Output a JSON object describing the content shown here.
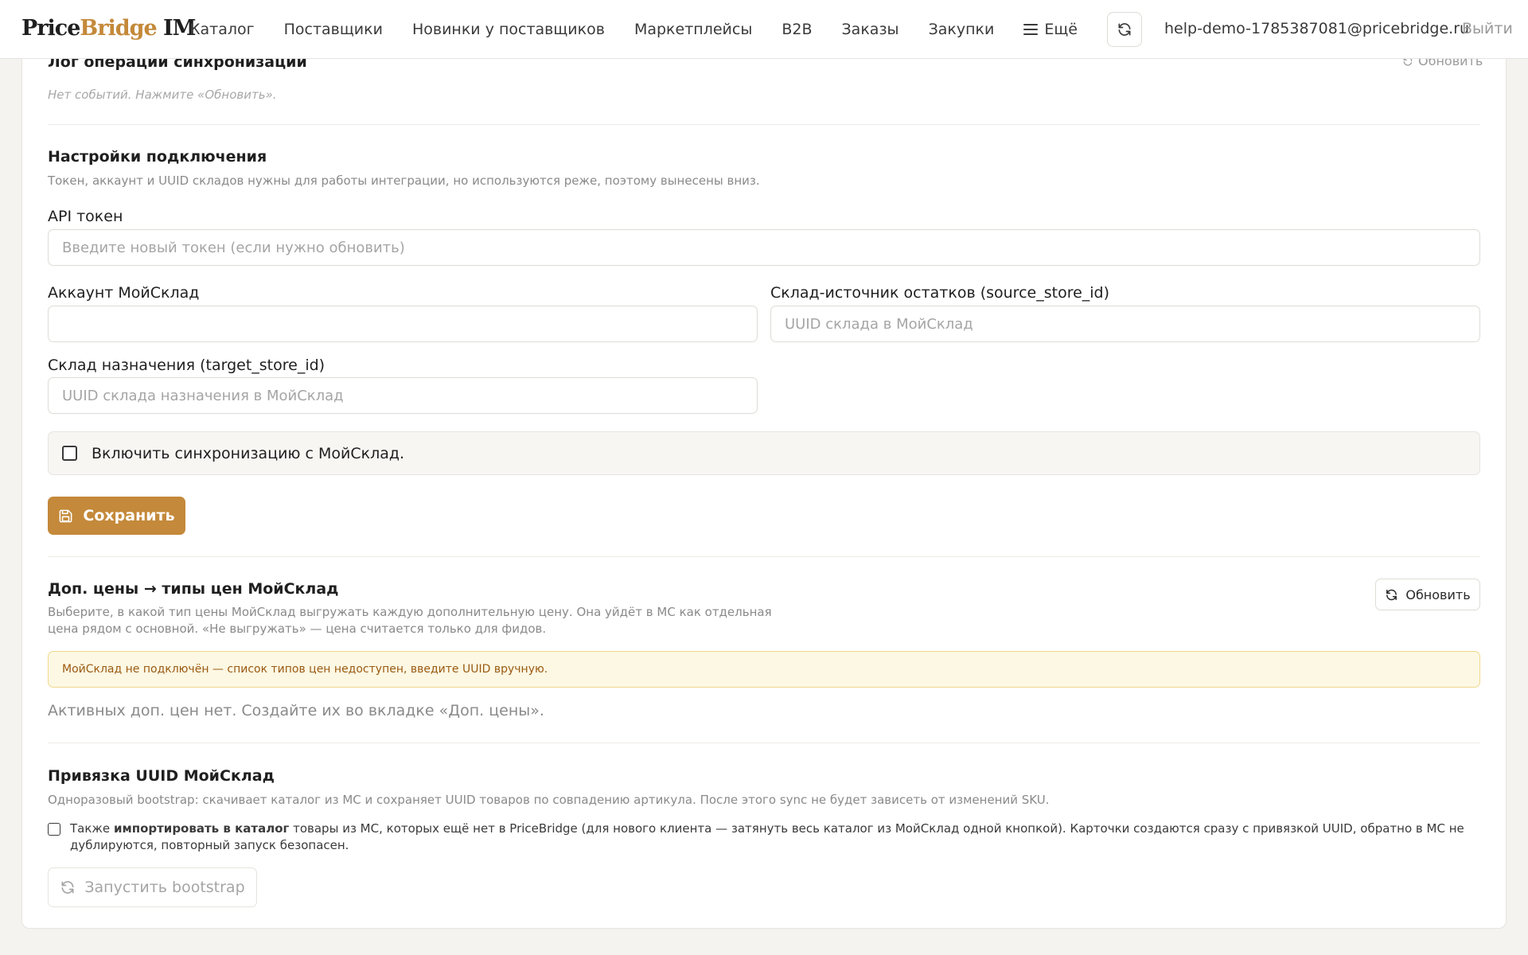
{
  "nav": {
    "logo_a": "Price",
    "logo_b": "Bridge",
    "logo_c": " IM",
    "items": [
      {
        "label": "Каталог"
      },
      {
        "label": "Поставщики"
      },
      {
        "label": "Новинки у поставщиков"
      },
      {
        "label": "Маркетплейсы"
      },
      {
        "label": "B2B"
      },
      {
        "label": "Заказы"
      },
      {
        "label": "Закупки"
      },
      {
        "label": "Ещё"
      }
    ],
    "user_email": "help-demo-1785387081@pricebridge.ru",
    "logout": "Выйти"
  },
  "sync_log": {
    "title": "Лог операций синхронизации",
    "refresh": "Обновить",
    "empty": "Нет событий. Нажмите «Обновить»."
  },
  "connection": {
    "title": "Настройки подключения",
    "subtitle": "Токен, аккаунт и UUID складов нужны для работы интеграции, но используются реже, поэтому вынесены вниз.",
    "api_token_label": "API токен",
    "api_token_placeholder": "Введите новый токен (если нужно обновить)",
    "api_token_value": "",
    "account_label": "Аккаунт МойСклад",
    "account_value": "",
    "source_store_label": "Склад-источник остатков (source_store_id)",
    "source_store_placeholder": "UUID склада в МойСклад",
    "target_store_label": "Склад назначения (target_store_id)",
    "target_store_placeholder": "UUID склада назначения в МойСклад",
    "enable_sync_label": "Включить синхронизацию с МойСклад.",
    "enable_sync_checked": false,
    "save_label": "Сохранить"
  },
  "extra_prices": {
    "title": "Доп. цены → типы цен МойСклад",
    "refresh": "Обновить",
    "desc_line1": "Выберите, в какой тип цены МойСклад выгружать каждую дополнительную цену. Она уйдёт в МС как отдельная",
    "desc_line2": "цена рядом с основной. «Не выгружать» — цена считается только для фидов.",
    "warning": "МойСклад не подключён — список типов цен недоступен, введите UUID вручную.",
    "empty": "Активных доп. цен нет. Создайте их во вкладке «Доп. цены»."
  },
  "uuid_binding": {
    "title": "Привязка UUID МойСклад",
    "subtitle": "Одноразовый bootstrap: скачивает каталог из МС и сохраняет UUID товаров по совпадению артикула. После этого sync не будет зависеть от изменений SKU.",
    "import_prefix": "Также ",
    "import_bold": "импортировать в каталог",
    "import_rest_line1": " товары из МС, которых ещё нет в PriceBridge (для нового клиента — затянуть весь каталог из МойСклад одной кнопкой). Карточки создаются сразу с привязкой UUID, обратно в МС не",
    "import_line2": "дублируются, повторный запуск безопасен.",
    "import_checked": false,
    "bootstrap_label": "Запустить bootstrap"
  },
  "colors": {
    "accent": "#c4893a",
    "warning_bg": "#fdf8e3",
    "warning_text": "#9a5a12"
  }
}
